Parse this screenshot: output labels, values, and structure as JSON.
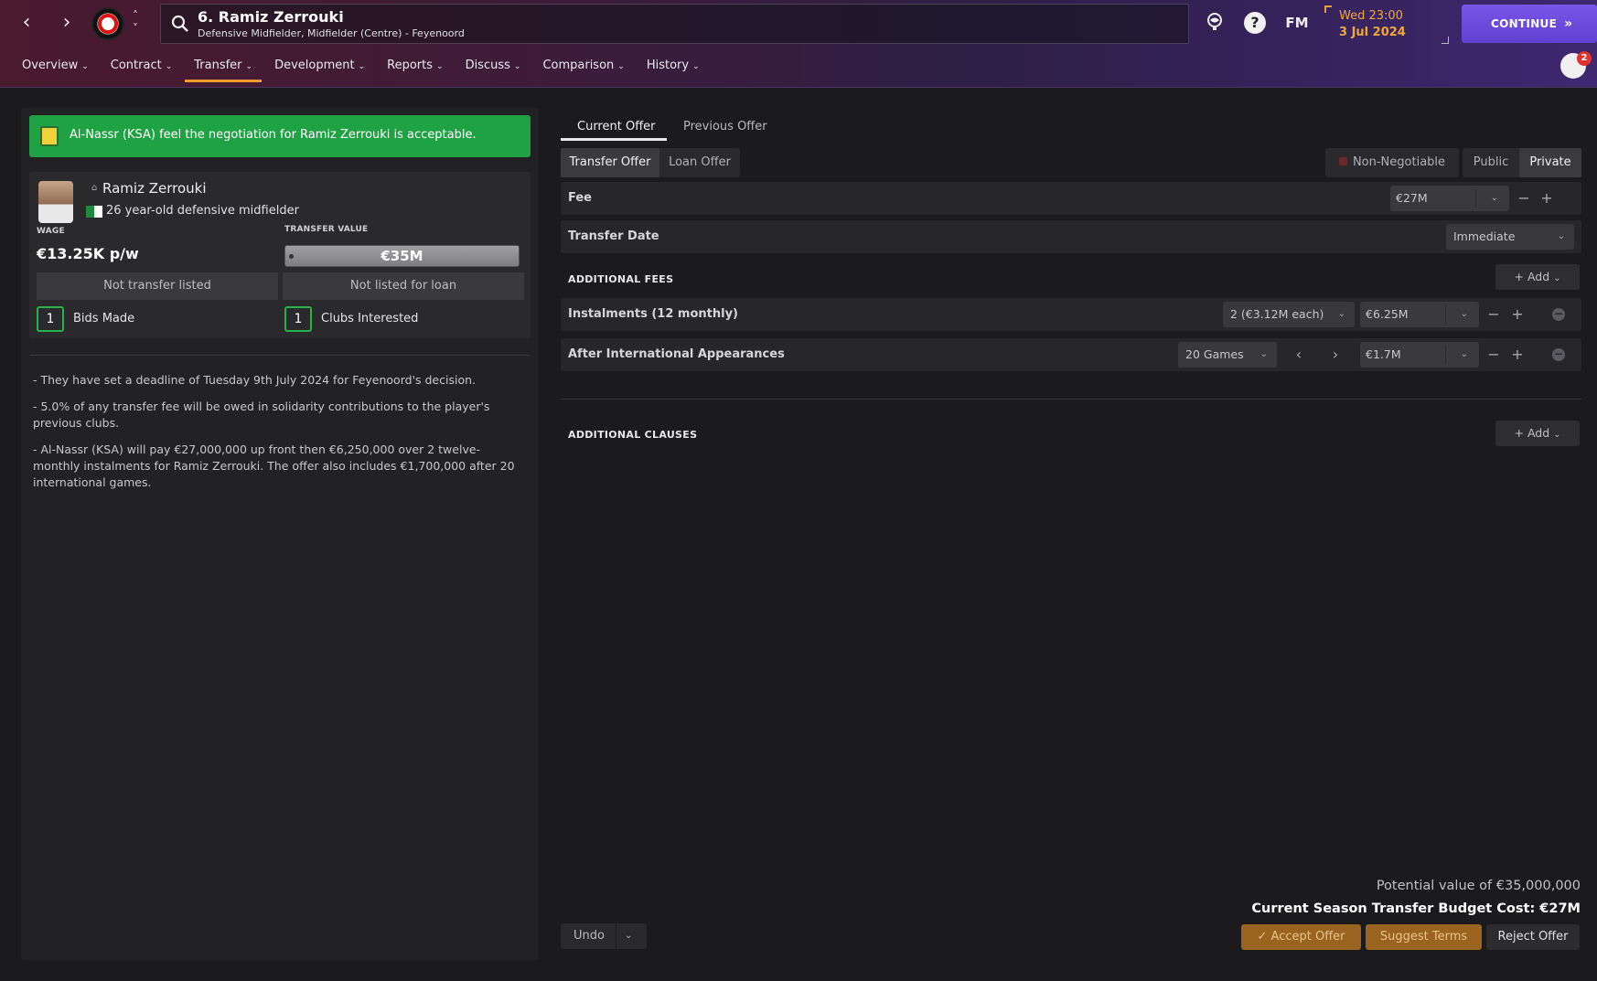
{
  "header": {
    "player_title": "6. Ramiz Zerrouki",
    "player_subtitle": "Defensive Midfielder, Midfielder (Centre) - Feyenoord",
    "fm_label": "FM",
    "date_time": "Wed 23:00",
    "date_day": "3 Jul 2024",
    "continue_label": "CONTINUE",
    "notification_count": "2"
  },
  "menu": [
    {
      "label": "Overview"
    },
    {
      "label": "Contract"
    },
    {
      "label": "Transfer",
      "active": true
    },
    {
      "label": "Development"
    },
    {
      "label": "Reports"
    },
    {
      "label": "Discuss"
    },
    {
      "label": "Comparison"
    },
    {
      "label": "History"
    }
  ],
  "left": {
    "alert_text": "Al-Nassr (KSA) feel the negotiation for Ramiz Zerrouki is acceptable.",
    "player_name": "Ramiz Zerrouki",
    "player_desc": "26 year-old defensive midfielder",
    "wage_label": "WAGE",
    "wage_value": "€13.25K p/w",
    "tv_label": "TRANSFER VALUE",
    "tv_value": "€35M",
    "transfer_status": "Not transfer listed",
    "loan_status": "Not listed for loan",
    "bids_count": "1",
    "bids_label": "Bids Made",
    "clubs_count": "1",
    "clubs_label": "Clubs Interested",
    "notes": [
      "- They have set a deadline of Tuesday 9th July 2024 for Feyenoord's decision.",
      "- 5.0% of any transfer fee will be owed in solidarity contributions to the player's previous clubs.",
      "- Al-Nassr (KSA) will pay €27,000,000 up front then €6,250,000 over 2 twelve-monthly instalments for Ramiz Zerrouki. The offer also includes €1,700,000 after 20 international games."
    ]
  },
  "offer": {
    "tabs": [
      "Current Offer",
      "Previous Offer"
    ],
    "offer_types": [
      "Transfer Offer",
      "Loan Offer"
    ],
    "non_negotiable": "Non-Negotiable",
    "visibility": [
      "Public",
      "Private"
    ],
    "fee_label": "Fee",
    "fee_value": "€27M",
    "transfer_date_label": "Transfer Date",
    "transfer_date_value": "Immediate",
    "additional_fees_label": "ADDITIONAL FEES",
    "add_label": "Add",
    "instalments_label": "Instalments (12 monthly)",
    "instalments_select": "2 (€3.12M each)",
    "instalments_value": "€6.25M",
    "appearances_label": "After International Appearances",
    "appearances_select": "20 Games",
    "appearances_value": "€1.7M",
    "additional_clauses_label": "ADDITIONAL CLAUSES",
    "potential_value": "Potential value of €35,000,000",
    "budget_cost": "Current Season Transfer Budget Cost: €27M",
    "undo_label": "Undo",
    "accept_label": "Accept Offer",
    "suggest_label": "Suggest Terms",
    "reject_label": "Reject Offer"
  }
}
